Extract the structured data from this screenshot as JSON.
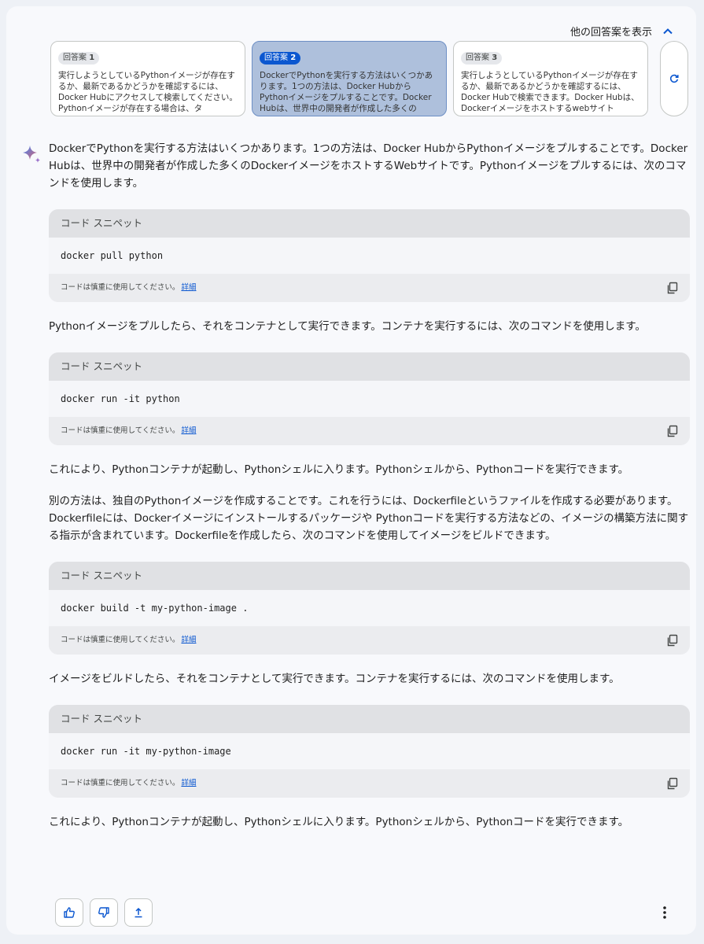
{
  "header": {
    "toggle_label": "他の回答案を表示"
  },
  "drafts": [
    {
      "label": "回答案",
      "num": "1",
      "text": "実行しようとしているPythonイメージが存在するか、最新であるかどうかを確認するには、Docker Hubにアクセスして検索してください。Pythonイメージが存在する場合は、タ"
    },
    {
      "label": "回答案",
      "num": "2",
      "text": "DockerでPythonを実行する方法はいくつかあります。1つの方法は、Docker HubからPythonイメージをプルすることです。Docker Hubは、世界中の開発者が作成した多くのDocker"
    },
    {
      "label": "回答案",
      "num": "3",
      "text": "実行しようとしているPythonイメージが存在するか、最新であるかどうかを確認するには、Docker Hubで検索できます。Docker Hubは、Dockerイメージをホストするwebサイト"
    }
  ],
  "response": {
    "p1": "DockerでPythonを実行する方法はいくつかあります。1つの方法は、Docker HubからPythonイメージをプルすることです。Docker Hubは、世界中の開発者が作成した多くのDockerイメージをホストするWebサイトです。Pythonイメージをプルするには、次のコマンドを使用します。",
    "p2": "Pythonイメージをプルしたら、それをコンテナとして実行できます。コンテナを実行するには、次のコマンドを使用します。",
    "p3": "これにより、Pythonコンテナが起動し、Pythonシェルに入ります。Pythonシェルから、Pythonコードを実行できます。",
    "p4": "別の方法は、独自のPythonイメージを作成することです。これを行うには、Dockerfileというファイルを作成する必要があります。Dockerfileには、Dockerイメージにインストールするパッケージや Pythonコードを実行する方法などの、イメージの構築方法に関する指示が含まれています。Dockerfileを作成したら、次のコマンドを使用してイメージをビルドできます。",
    "p5": "イメージをビルドしたら、それをコンテナとして実行できます。コンテナを実行するには、次のコマンドを使用します。",
    "p6": "これにより、Pythonコンテナが起動し、Pythonシェルに入ります。Pythonシェルから、Pythonコードを実行できます。"
  },
  "code_blocks": [
    {
      "header": "コード スニペット",
      "code": "docker pull python",
      "note": "コードは慎重に使用してください。",
      "link": "詳細"
    },
    {
      "header": "コード スニペット",
      "code": "docker run -it python",
      "note": "コードは慎重に使用してください。",
      "link": "詳細"
    },
    {
      "header": "コード スニペット",
      "code": "docker build -t my-python-image .",
      "note": "コードは慎重に使用してください。",
      "link": "詳細"
    },
    {
      "header": "コード スニペット",
      "code": "docker run -it my-python-image",
      "note": "コードは慎重に使用してください。",
      "link": "詳細"
    }
  ],
  "icons": {
    "toggle": "chevron-up-icon",
    "regenerate": "refresh-icon",
    "assistant": "sparkle-icon",
    "copy": "copy-icon",
    "like": "thumb-up-icon",
    "dislike": "thumb-down-icon",
    "share": "share-icon",
    "more": "more-vert-icon"
  },
  "colors": {
    "accent": "#0b57d0",
    "selected_draft": "#aec0dc"
  }
}
